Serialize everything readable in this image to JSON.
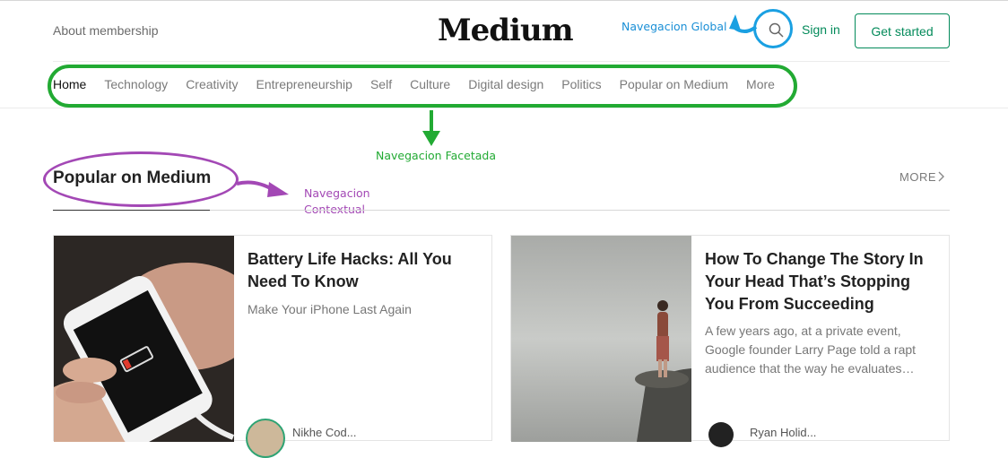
{
  "header": {
    "about": "About membership",
    "logo": "Medium",
    "search_icon": "search-icon",
    "signin": "Sign in",
    "get_started": "Get started"
  },
  "nav": {
    "items": [
      {
        "label": "Home",
        "active": true
      },
      {
        "label": "Technology"
      },
      {
        "label": "Creativity"
      },
      {
        "label": "Entrepreneurship"
      },
      {
        "label": "Self"
      },
      {
        "label": "Culture"
      },
      {
        "label": "Digital design"
      },
      {
        "label": "Politics"
      },
      {
        "label": "Popular on Medium"
      },
      {
        "label": "More"
      }
    ]
  },
  "annotations": {
    "global": "Navegacion Global",
    "facet": "Navegacion Facetada",
    "context_line1": "Navegacion",
    "context_line2": "Contextual"
  },
  "section": {
    "title": "Popular on Medium",
    "more": "MORE"
  },
  "cards": [
    {
      "title": "Battery Life Hacks: All You Need To Know",
      "subtitle": "Make Your iPhone Last Again",
      "author": "Nikhe Cod..."
    },
    {
      "title": "How To Change The Story In Your Head That’s Stopping You From Succeeding",
      "subtitle": "A few years ago, at a private event, Google founder Larry Page told a rapt audience that the way he evaluates…",
      "author": "Ryan Holid..."
    }
  ],
  "colors": {
    "brand_green": "#038a5a",
    "annot_blue": "#1a8fd6",
    "annot_green": "#22aa33",
    "annot_purple": "#a348b5"
  }
}
